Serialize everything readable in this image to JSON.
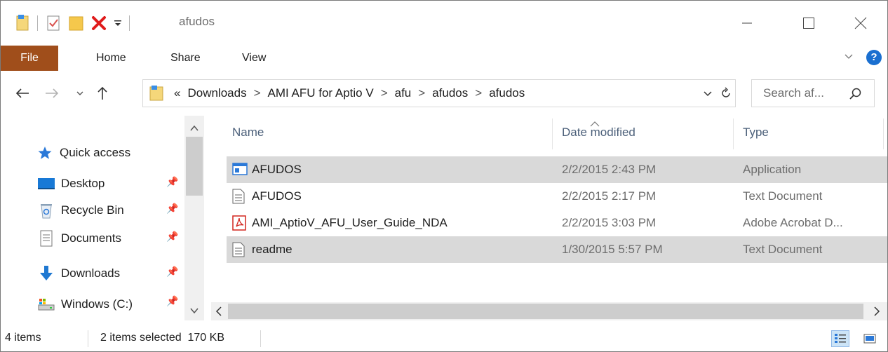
{
  "window": {
    "title": "afudos"
  },
  "quick_access_toolbar": {
    "icons": [
      "properties-icon",
      "new-folder-icon",
      "folder-icon",
      "delete-icon",
      "customize-dropdown-icon"
    ]
  },
  "ribbon": {
    "tabs": [
      {
        "label": "File",
        "active": true
      },
      {
        "label": "Home"
      },
      {
        "label": "Share"
      },
      {
        "label": "View"
      }
    ],
    "accent_color": "#a04e1b"
  },
  "address_bar": {
    "overflow": "«",
    "path": [
      "Downloads",
      "AMI AFU for Aptio V",
      "afu",
      "afudos",
      "afudos"
    ],
    "separator": ">"
  },
  "search": {
    "placeholder": "Search af..."
  },
  "navigation_pane": {
    "items": [
      {
        "label": "Quick access",
        "icon": "star-icon",
        "pinned": false
      },
      {
        "label": "Desktop",
        "icon": "desktop-icon",
        "pinned": true
      },
      {
        "label": "Recycle Bin",
        "icon": "recycle-bin-icon",
        "pinned": true
      },
      {
        "label": "Documents",
        "icon": "documents-icon",
        "pinned": true
      },
      {
        "label": "Downloads",
        "icon": "download-icon",
        "pinned": true
      },
      {
        "label": "Windows (C:)",
        "icon": "drive-icon",
        "pinned": true
      }
    ]
  },
  "file_list": {
    "columns": {
      "name": "Name",
      "date": "Date modified",
      "type": "Type"
    },
    "sort_column": "Name",
    "rows": [
      {
        "name": "AFUDOS",
        "date": "2/2/2015 2:43 PM",
        "type": "Application",
        "icon": "application-icon",
        "selected": true
      },
      {
        "name": "AFUDOS",
        "date": "2/2/2015 2:17 PM",
        "type": "Text Document",
        "icon": "text-file-icon",
        "selected": false
      },
      {
        "name": "AMI_AptioV_AFU_User_Guide_NDA",
        "date": "2/2/2015 3:03 PM",
        "type": "Adobe Acrobat D...",
        "icon": "pdf-icon",
        "selected": false
      },
      {
        "name": "readme",
        "date": "1/30/2015 5:57 PM",
        "type": "Text Document",
        "icon": "text-file-icon",
        "selected": true
      }
    ]
  },
  "status_bar": {
    "item_count": "4 items",
    "selection": "2 items selected  170 KB",
    "views": [
      "details-view-icon",
      "large-icons-view-icon"
    ],
    "active_view": "details-view-icon"
  }
}
